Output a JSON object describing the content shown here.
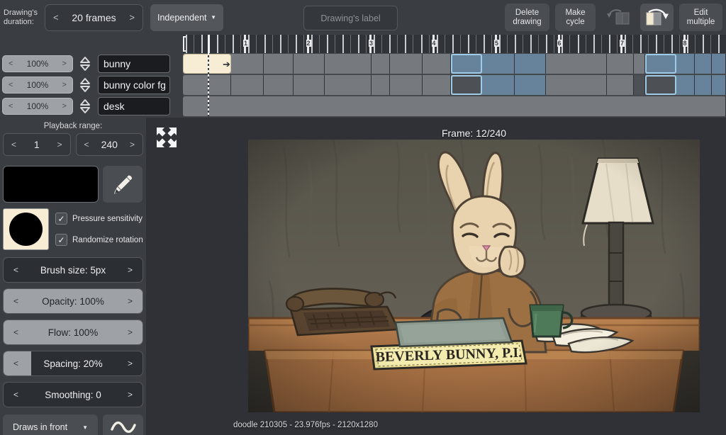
{
  "topbar": {
    "duration_label": "Drawing's\nduration:",
    "duration_label_line1": "Drawing's",
    "duration_label_line2": "duration:",
    "duration_value": "20 frames",
    "prev_arrow": "<",
    "next_arrow": ">",
    "independent_label": "Independent",
    "caret": "▼",
    "drawing_label_placeholder": "Drawing's label",
    "buttons": [
      {
        "name": "delete-drawing",
        "line1": "Delete",
        "line2": "drawing"
      },
      {
        "name": "make-cycle",
        "line1": "Make",
        "line2": "cycle"
      },
      {
        "name": "edit-multiple",
        "line1": "Edit",
        "line2": "multiple"
      }
    ],
    "onion_prev_icon": "onion-skin-previous-icon",
    "onion_next_icon": "onion-skin-next-icon"
  },
  "ruler": {
    "second_marks": [
      "1",
      "2",
      "3",
      "4",
      "5",
      "6",
      "7",
      "8"
    ]
  },
  "layers": [
    {
      "name": "bunny",
      "opacity": "100%"
    },
    {
      "name": "bunny color fg",
      "opacity": "100%"
    },
    {
      "name": "desk",
      "opacity": "100%"
    }
  ],
  "timeline": {
    "playhead_frame": 12,
    "selected_clip_label": "",
    "clip_arrow": "➔"
  },
  "playback": {
    "title": "Playback range:",
    "start": "1",
    "end": "240",
    "prev_arrow": "<",
    "next_arrow": ">"
  },
  "tools": {
    "color_hex": "#000000",
    "eyedropper_icon": "eyedropper-icon",
    "brush_preview_bg": "#f7edd4",
    "brush_dot_color": "#000000",
    "checkboxes": [
      {
        "label": "Pressure sensitivity",
        "checked": true
      },
      {
        "label": "Randomize rotation",
        "checked": true
      }
    ],
    "check_glyph": "✓",
    "sliders": [
      {
        "name": "brush-size",
        "label": "Brush size: 5px",
        "fill_pct": 0
      },
      {
        "name": "opacity",
        "label": "Opacity: 100%",
        "fill_pct": 100
      },
      {
        "name": "flow",
        "label": "Flow: 100%",
        "fill_pct": 100
      },
      {
        "name": "spacing",
        "label": "Spacing: 20%",
        "fill_pct": 20
      },
      {
        "name": "smoothing",
        "label": "Smoothing: 0",
        "fill_pct": 0
      }
    ],
    "slider_prev_arrow": "<",
    "slider_next_arrow": ">",
    "draws_in_front_label": "Draws in front",
    "draws_caret": "▼",
    "wave_icon": "wave-smoothing-icon"
  },
  "canvas": {
    "fullscreen_icon": "fullscreen-expand-icon",
    "frame_counter": "Frame: 12/240",
    "status": "doodle 210305 - 23.976fps - 2120x1280",
    "artwork": {
      "description": "detective-bunny-at-desk",
      "nameplate_text": "BEVERLY BUNNY, P.I.",
      "colors": {
        "wall": "#5d5a53",
        "desk": "#b07a4e",
        "bunny_fur": "#e8d3ae",
        "bunny_coat": "#9c7042",
        "lamp_shade": "#e6ddc8",
        "mug": "#4e7a5a",
        "chair": "#2a2a2c"
      }
    }
  }
}
